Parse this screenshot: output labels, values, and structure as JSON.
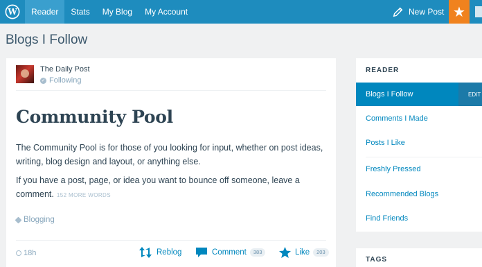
{
  "topbar": {
    "nav": [
      "Reader",
      "Stats",
      "My Blog",
      "My Account"
    ],
    "new_post_label": "New Post",
    "notifications_icon": "star-icon"
  },
  "page": {
    "title": "Blogs I Follow"
  },
  "post": {
    "site_name": "The Daily Post",
    "follow_status": "Following",
    "title": "Community Pool",
    "paragraphs": [
      "The Community Pool is for those of you looking for input, whether on post ideas, writing, blog design and layout, or anything else.",
      "If you have a post, page, or idea you want to bounce off someone, leave a comment."
    ],
    "more_words": "152 MORE WORDS",
    "tag": "Blogging",
    "time": "18h",
    "reblog_label": "Reblog",
    "comment_label": "Comment",
    "comment_count": "383",
    "like_label": "Like",
    "like_count": "203"
  },
  "sidebar": {
    "heading": "READER",
    "items": [
      "Blogs I Follow",
      "Comments I Made",
      "Posts I Like",
      "Freshly Pressed",
      "Recommended Blogs",
      "Find Friends"
    ],
    "edit_label": "EDIT",
    "tags_heading": "TAGS"
  },
  "colors": {
    "topbar": "#1e8cbe",
    "accent": "#0087be",
    "notification": "#f0821e"
  }
}
